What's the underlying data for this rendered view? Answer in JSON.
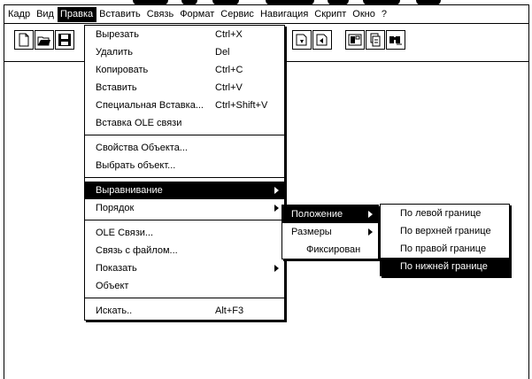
{
  "menubar": {
    "items": [
      {
        "label": "Кадр"
      },
      {
        "label": "Вид"
      },
      {
        "label": "Правка"
      },
      {
        "label": "Вставить"
      },
      {
        "label": "Связь"
      },
      {
        "label": "Формат"
      },
      {
        "label": "Сервис"
      },
      {
        "label": "Навигация"
      },
      {
        "label": "Скрипт"
      },
      {
        "label": "Окно"
      },
      {
        "label": "?"
      }
    ]
  },
  "edit_menu": {
    "items": [
      {
        "label": "Вырезать",
        "shortcut": "Ctrl+X"
      },
      {
        "label": "Удалить",
        "shortcut": "Del"
      },
      {
        "label": "Копировать",
        "shortcut": "Ctrl+C"
      },
      {
        "label": "Вставить",
        "shortcut": "Ctrl+V"
      },
      {
        "label": "Специальная Вставка...",
        "shortcut": "Ctrl+Shift+V"
      },
      {
        "label": "Вставка OLE связи",
        "shortcut": ""
      },
      {
        "label": "Свойства Объекта...",
        "shortcut": ""
      },
      {
        "label": "Выбрать объект...",
        "shortcut": ""
      },
      {
        "label": "Выравнивание",
        "shortcut": ""
      },
      {
        "label": "Порядок",
        "shortcut": ""
      },
      {
        "label": "OLE Связи...",
        "shortcut": ""
      },
      {
        "label": "Связь с файлом...",
        "shortcut": ""
      },
      {
        "label": "Показать",
        "shortcut": ""
      },
      {
        "label": "Объект",
        "shortcut": ""
      },
      {
        "label": "Искать..",
        "shortcut": "Alt+F3"
      }
    ]
  },
  "align_menu": {
    "items": [
      {
        "label": "Положение"
      },
      {
        "label": "Размеры"
      },
      {
        "label": "Фиксирован"
      }
    ]
  },
  "position_menu": {
    "items": [
      {
        "label": "По левой границе"
      },
      {
        "label": "По верхней границе"
      },
      {
        "label": "По правой границе"
      },
      {
        "label": "По нижней границе"
      }
    ]
  }
}
